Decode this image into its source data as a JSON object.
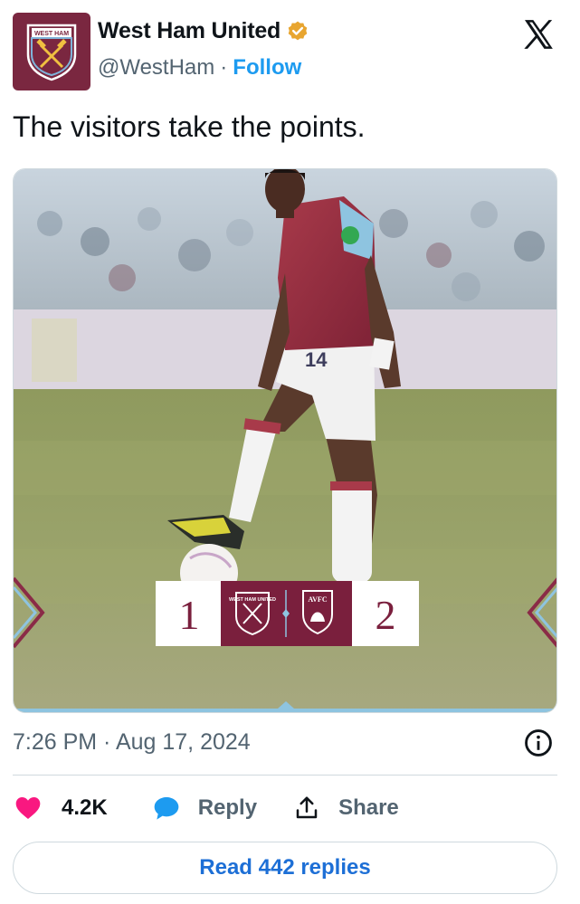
{
  "account": {
    "name": "West Ham United",
    "handle": "@WestHam",
    "separator": "·",
    "follow_label": "Follow",
    "avatar_icon": "west-ham-crest-icon",
    "badge_color": "#e8a52f"
  },
  "brand_icon": "x-logo-icon",
  "tweet": {
    "text": "The visitors take the points.",
    "timestamp": "7:26 PM · Aug 17, 2024"
  },
  "media": {
    "scoreboard": {
      "home_score": "1",
      "away_score": "2",
      "home_crest_text": "WEST HAM UNITED",
      "away_crest_text": "AVFC",
      "claret": "#7a1f3d"
    },
    "player_number": "14"
  },
  "actions": {
    "like_count": "4.2K",
    "reply_label": "Reply",
    "share_label": "Share",
    "like_color": "#f91880",
    "reply_color": "#1d9bf0"
  },
  "read_replies_label": "Read 442 replies"
}
